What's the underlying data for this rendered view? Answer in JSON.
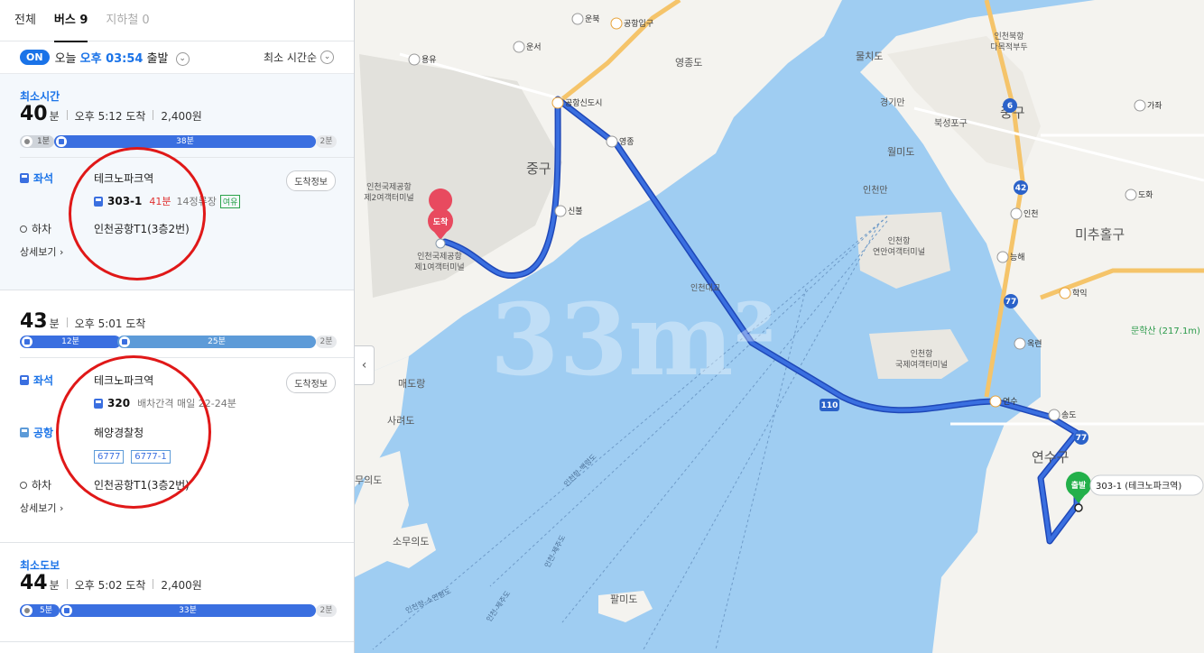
{
  "tabs": [
    {
      "label": "전체"
    },
    {
      "label": "버스 9"
    },
    {
      "label": "지하철 0"
    }
  ],
  "depart": {
    "on_label": "ON",
    "prefix": "오늘",
    "time": "오후 03:54",
    "suffix": "출발",
    "sort_label": "최소 시간순"
  },
  "routes": [
    {
      "tag": "최소시간",
      "minutes": "40",
      "unit": "분",
      "arrive": "오후 5:12 도착",
      "fare": "2,400원",
      "bar": {
        "walk1": "1분",
        "bus1": "38분",
        "tail": "2분"
      },
      "seat_label": "좌석",
      "board_stop": "테크노파크역",
      "arrival_btn": "도착정보",
      "bus_num": "303-1",
      "eta": "41분",
      "eta_detail": "14정류장",
      "seat_badge": "여유",
      "alight_label": "하차",
      "alight_stop": "인천공항T1(3층2번)",
      "detail": "상세보기"
    },
    {
      "minutes": "43",
      "unit": "분",
      "arrive": "오후 5:01 도착",
      "bar": {
        "bus1": "12분",
        "bus2": "25분",
        "tail": "2분"
      },
      "seat_label": "좌석",
      "board_stop": "테크노파크역",
      "arrival_btn": "도착정보",
      "bus_num": "320",
      "interval": "배차간격 매일 22-24분",
      "transfer_label": "공항",
      "transfer_stop": "해양경찰청",
      "transfer_chips": [
        "6777",
        "6777-1"
      ],
      "alight_label": "하차",
      "alight_stop": "인천공항T1(3층2번)",
      "detail": "상세보기"
    },
    {
      "tag": "최소도보",
      "minutes": "44",
      "unit": "분",
      "arrive": "오후 5:02 도착",
      "fare": "2,400원",
      "bar": {
        "walk1": "5분",
        "bus1": "33분",
        "tail": "2분"
      }
    }
  ],
  "map": {
    "arrive_pin": "도착",
    "depart_pin": "출발",
    "depart_label": "303-1 (테크노파크역)",
    "watermark": "33m²",
    "route_color": "#3a6fe0",
    "land_color": "#f4f3ef",
    "water_color": "#9fcdf2",
    "labels": {
      "jung_gu": "중구",
      "jung_gu2": "중구",
      "yeongjongdo": "영종도",
      "mulchido": "물치도",
      "gyeonginhang": "경기만",
      "bukseongpogu": "북성포구",
      "wolmido": "월미도",
      "incheonman": "인천만",
      "michuhol": "미추홀구",
      "yeonsu": "연수구",
      "maedorang": "매도랑",
      "saryeodo": "사려도",
      "muuido": "무의도",
      "somuuido": "소무의도",
      "palmido": "팔미도",
      "terminal2": "인천국제공항\n제2여객터미널",
      "terminal1": "인천국제공항\n제1여객터미널",
      "coastal_terminal": "인천항\n연안여객터미널",
      "intl_terminal": "인천항\n국제여객터미널",
      "mun_mountain": "문학산\n(217.1m)",
      "incheon_bridge": "인천대교",
      "incheon_north": "인천북항\n다목적부두"
    },
    "ic": [
      {
        "label": "운북"
      },
      {
        "label": "공항입구"
      },
      {
        "label": "운서"
      },
      {
        "label": "용유"
      },
      {
        "label": "공항신도시"
      },
      {
        "label": "영종"
      },
      {
        "label": "신불"
      },
      {
        "label": "도화"
      },
      {
        "label": "인천"
      },
      {
        "label": "능해"
      },
      {
        "label": "학익"
      },
      {
        "label": "옥련"
      },
      {
        "label": "연수"
      },
      {
        "label": "송도"
      },
      {
        "label": "가좌"
      }
    ],
    "shields": [
      "6",
      "42",
      "77",
      "77",
      "110"
    ],
    "sea_routes": [
      "인천항-백령도",
      "인천항-소연평도",
      "인천-제주도",
      "인천-제주도"
    ]
  }
}
